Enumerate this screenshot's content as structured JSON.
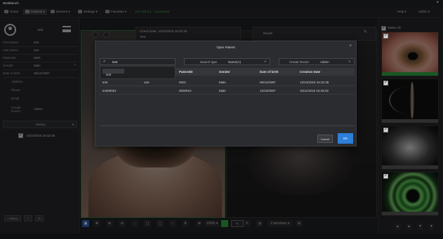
{
  "app": {
    "title": "Workbench",
    "close_glyph": "×"
  },
  "menu": {
    "items": [
      {
        "label": "Home",
        "icon": "home-icon"
      },
      {
        "label": "Patients ▾",
        "icon": "patients-icon"
      },
      {
        "label": "Devices ▾",
        "icon": "devices-icon"
      },
      {
        "label": "Settings ▾",
        "icon": "settings-icon"
      },
      {
        "label": "Favorites ▾",
        "icon": "favorites-icon"
      }
    ],
    "connection": "192.168.0.1 · Connected",
    "help": "Help ▾",
    "user": "Admin ▾"
  },
  "patient": {
    "name_short": "test",
    "fields": [
      {
        "label": "First Name",
        "value": "test"
      },
      {
        "label": "Last Name",
        "value": "one"
      },
      {
        "label": "PatientID",
        "value": "0001"
      },
      {
        "label": "Gender",
        "value": "Male",
        "caret": "▾"
      },
      {
        "label": "Date of birth",
        "value": "06/12/1987"
      },
      {
        "label": "Address",
        "value": ""
      },
      {
        "label": "Phone",
        "value": ""
      },
      {
        "label": "Email",
        "value": ""
      },
      {
        "label": "Create Doctor",
        "value": "Admin"
      }
    ]
  },
  "history": {
    "title": "History",
    "caret": "▾",
    "item": "12/24/2018 16:32:35"
  },
  "left_footer": {
    "history_btn": "‹ History",
    "btn2": "+",
    "btn3": "⊖"
  },
  "exam": {
    "date_label": "Check Date",
    "date_value": "12/24/2018 16:32:35",
    "line2": "Test",
    "result_label": "Result",
    "edit_glyph": "✎"
  },
  "toolbar": {
    "buttons": [
      "▣",
      "✥",
      "⊕",
      "⊖",
      "↔",
      "▢",
      "◯",
      "⟋",
      "A",
      "◐"
    ],
    "zoom": "100% ▾",
    "zoom_glyph": "⊕",
    "pen_glyph": "✎",
    "icon_glyph": "◍",
    "layout": "2 windows ▾",
    "layout_glyph": "⊞"
  },
  "thumbnails": {
    "select_all": "Select All",
    "items": [
      {
        "name": "thumb-eye-front"
      },
      {
        "name": "thumb-slit-lamp"
      },
      {
        "name": "thumb-lens"
      },
      {
        "name": "thumb-fluorescein"
      }
    ],
    "footer": [
      "▲",
      "▲",
      "▼",
      "▼"
    ]
  },
  "modal": {
    "title": "Open Patient",
    "close_glyph": "×",
    "search_icon": "⌕",
    "search_value": "test",
    "suggestion": "test",
    "search_type_label": "Search type",
    "search_type_value": "Name(A)",
    "create_doctor_label": "Create Doctor",
    "create_doctor_value": "Admin",
    "dropdown_caret": "▾",
    "columns": [
      "First N",
      "",
      "PatientID",
      "Gender",
      "Date of birth",
      "Creation Date"
    ],
    "rows": [
      [
        "test",
        "one",
        "0001",
        "Male",
        "06/12/1987",
        "12/24/2018 16:32:35"
      ],
      [
        "test00001",
        "",
        "0000010",
        "Male",
        "12/10/2007",
        "10/11/2019 16:45:02"
      ]
    ],
    "cancel": "Cancel",
    "ok": "OK"
  },
  "colors": {
    "accent": "#2d7fd9",
    "active_green": "#2f9e3f",
    "bg": "#1b1c1e"
  }
}
